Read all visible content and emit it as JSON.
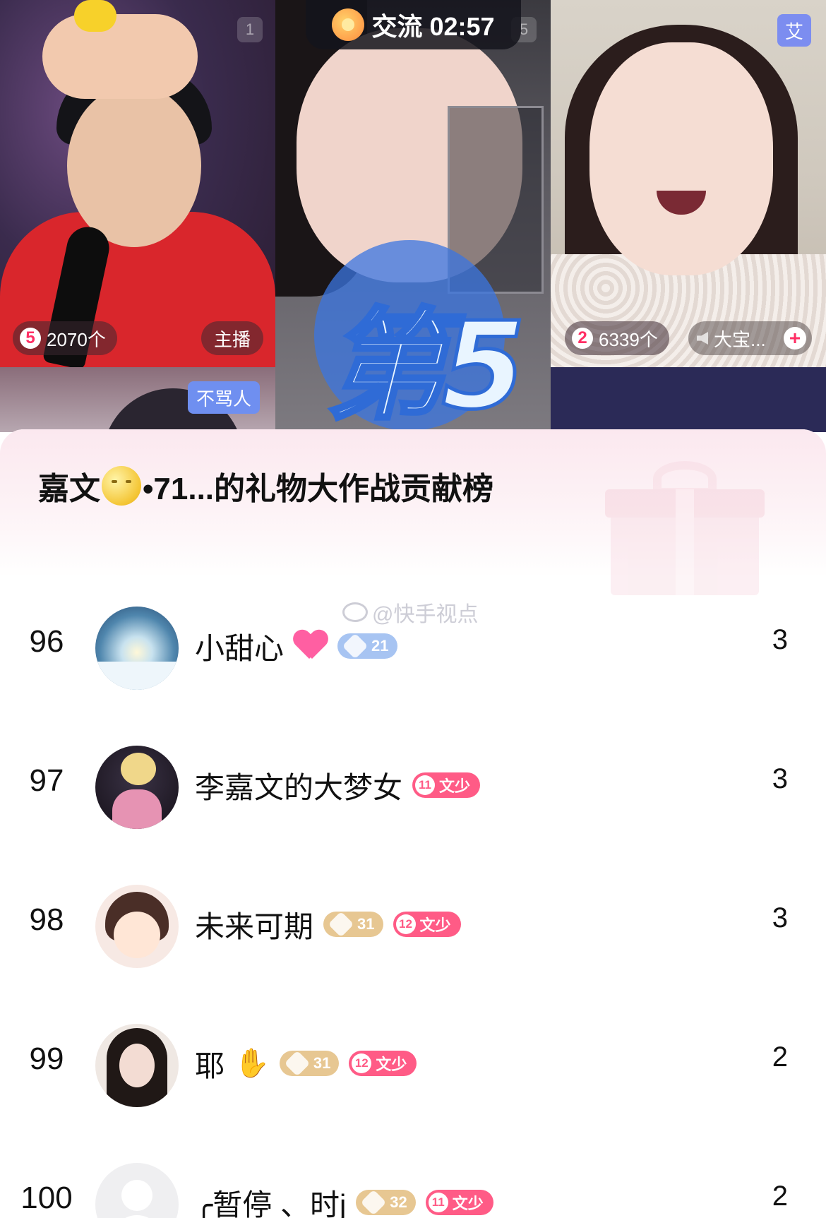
{
  "top_bar": {
    "timer_label": "交流 02:57",
    "ai_badge": "艾",
    "corner_numbers": [
      "1",
      "5"
    ]
  },
  "streams": {
    "left": {
      "rank": "5",
      "gift_count": "2070个",
      "role_tag": "主播"
    },
    "right": {
      "rank": "2",
      "gift_count": "6339个",
      "guest_name": "大宝...",
      "add_icon": "plus-icon"
    },
    "bottom_left_tag": "不骂人",
    "rank_badge": "第5"
  },
  "sheet": {
    "title_prefix": "嘉文",
    "title_suffix": "•71...的礼物大作战贡献榜",
    "watermark": "@快手视点"
  },
  "rows": [
    {
      "rank": "96",
      "name": "小甜心",
      "level": "21",
      "fan_level": "",
      "fan_name": "",
      "score": "3"
    },
    {
      "rank": "97",
      "name": "李嘉文的大梦女",
      "level": "",
      "fan_level": "11",
      "fan_name": "文少",
      "score": "3"
    },
    {
      "rank": "98",
      "name": "未来可期",
      "level": "31",
      "fan_level": "12",
      "fan_name": "文少",
      "score": "3"
    },
    {
      "rank": "99",
      "name": "耶",
      "level": "31",
      "fan_level": "12",
      "fan_name": "文少",
      "score": "2"
    },
    {
      "rank": "100",
      "name": "╭暂停 、时j",
      "level": "32",
      "fan_level": "11",
      "fan_name": "文少",
      "score": "2"
    }
  ],
  "colors": {
    "accent_pink": "#ff5b86",
    "level_blue": "#a7c4f2",
    "level_gold": "#e7c792",
    "header_tint": "#fbe8ef"
  }
}
